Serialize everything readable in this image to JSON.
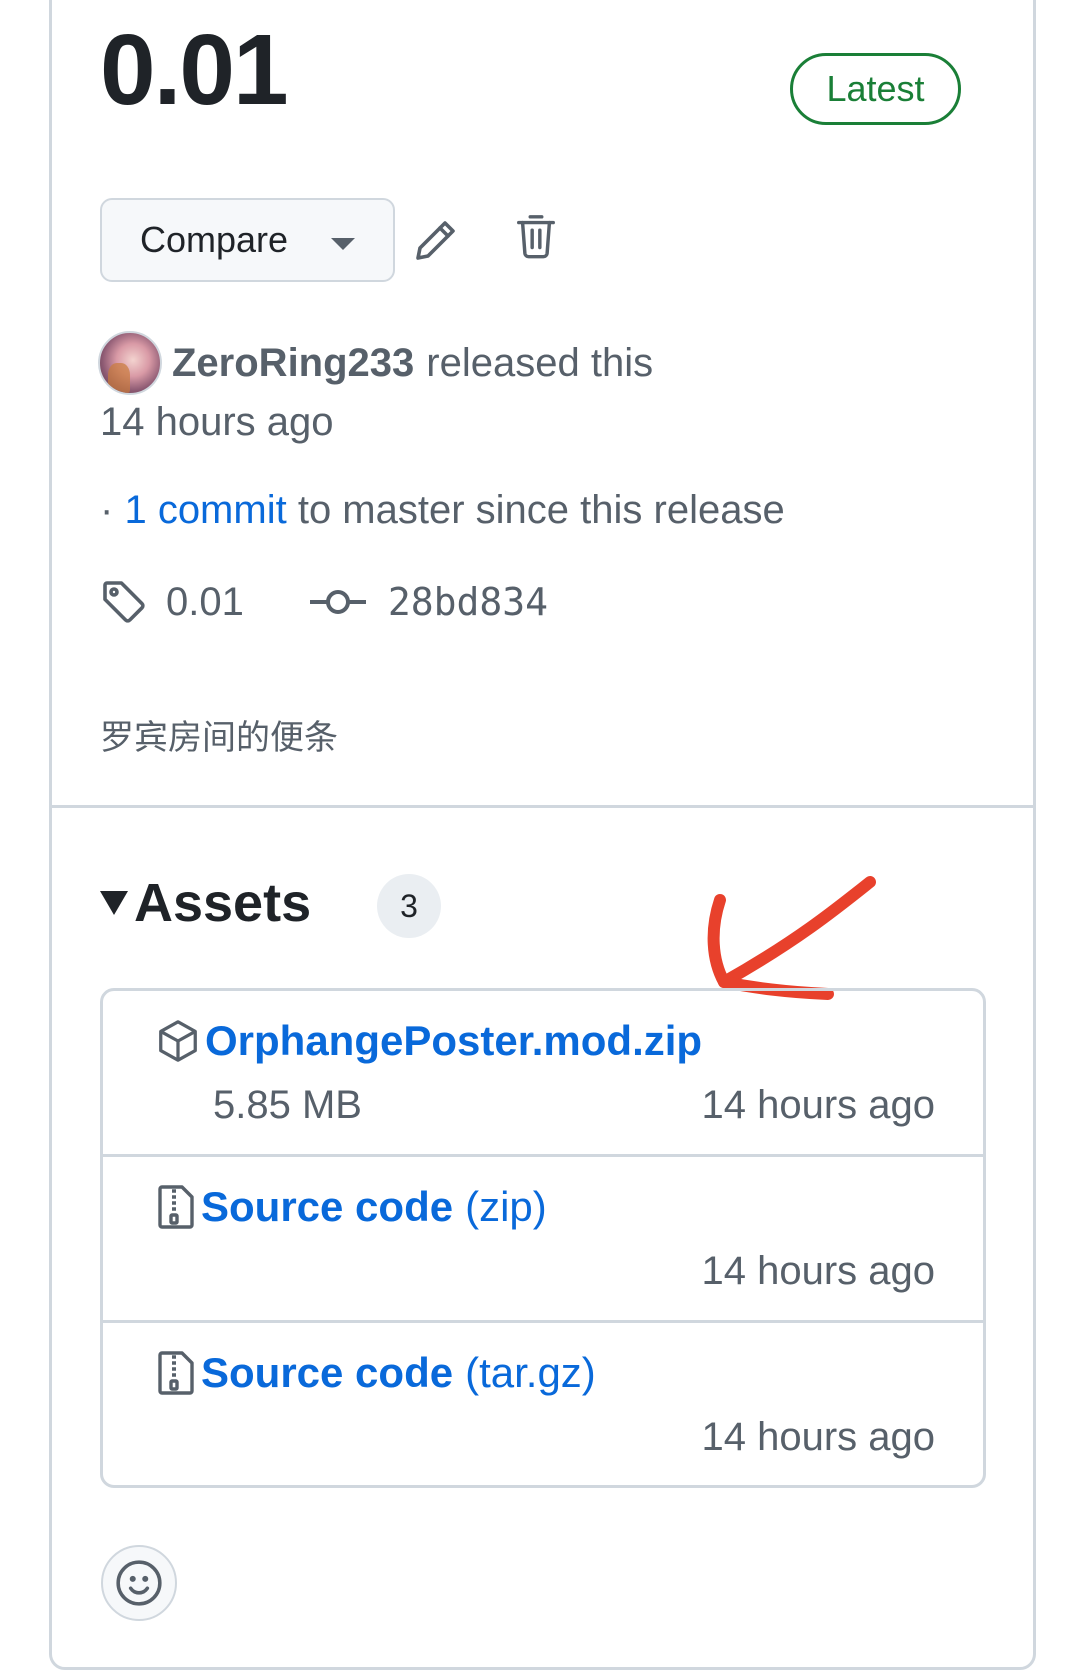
{
  "release": {
    "title": "0.01",
    "badge": "Latest",
    "compare_label": "Compare",
    "author": "ZeroRing233",
    "released_text": "released this",
    "time_ago": "14 hours ago",
    "commits_prefix": "·",
    "commits_link": "1 commit",
    "commits_suffix": "to master since this release",
    "tag": "0.01",
    "commit_sha": "28bd834",
    "notes": "罗宾房间的便条"
  },
  "assets": {
    "title": "Assets",
    "count": "3",
    "items": [
      {
        "name": "OrphangePoster.mod.zip",
        "suffix": "",
        "size": "5.85 MB",
        "time": "14 hours ago",
        "icon": "package-icon"
      },
      {
        "name": "Source code",
        "suffix": "(zip)",
        "size": "",
        "time": "14 hours ago",
        "icon": "file-zip-icon"
      },
      {
        "name": "Source code",
        "suffix": "(tar.gz)",
        "size": "",
        "time": "14 hours ago",
        "icon": "file-zip-icon"
      }
    ]
  },
  "colors": {
    "link": "#0969da",
    "success": "#1a7f37",
    "muted": "#57606a",
    "border": "#d0d7de",
    "annotation": "#e8412c"
  }
}
